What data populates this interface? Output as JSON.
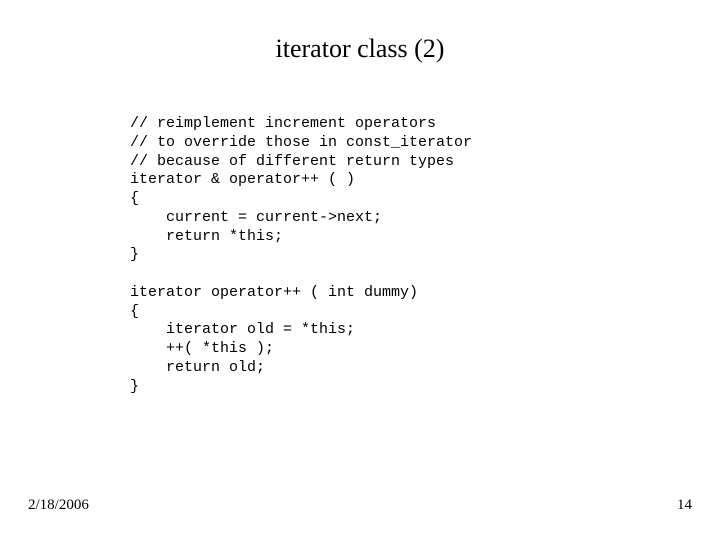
{
  "title": "iterator class (2)",
  "code": "// reimplement increment operators\n// to override those in const_iterator\n// because of different return types\niterator & operator++ ( )\n{\n    current = current->next;\n    return *this;\n}\n\niterator operator++ ( int dummy)\n{\n    iterator old = *this;\n    ++( *this );\n    return old;\n}",
  "footer": {
    "date": "2/18/2006",
    "page": "14"
  }
}
